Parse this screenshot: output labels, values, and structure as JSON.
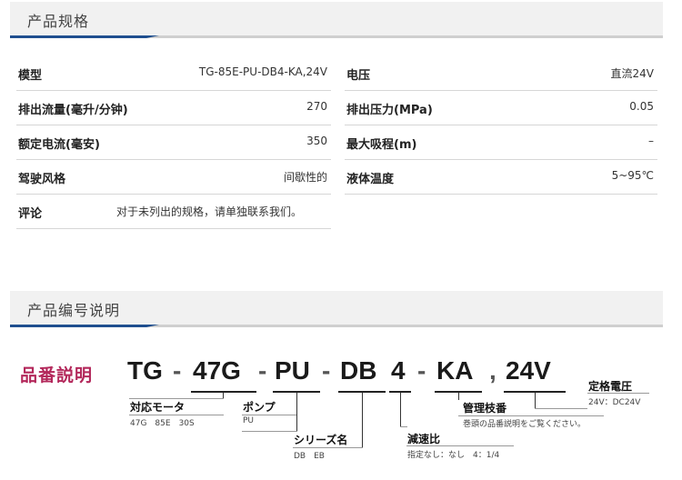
{
  "spec_section": {
    "title": "产品规格"
  },
  "spec_left": [
    {
      "label": "模型",
      "value": "TG-85E-PU-DB4-KA,24V"
    },
    {
      "label": "排出流量(毫升/分钟)",
      "value": "270"
    },
    {
      "label": "额定电流(毫安)",
      "value": "350"
    },
    {
      "label": "驾驶风格",
      "value": "间歇性的"
    }
  ],
  "spec_right": [
    {
      "label": "电压",
      "value": "直流24V"
    },
    {
      "label": "排出压力(MPa)",
      "value": "0.05"
    },
    {
      "label": "最大吸程(m)",
      "value": "–"
    },
    {
      "label": "液体温度",
      "value": "5~95℃"
    }
  ],
  "comment": {
    "label": "评论",
    "value": "对于未列出的规格，请单独联系我们。"
  },
  "code_section": {
    "title": "产品编号说明"
  },
  "code": {
    "heading": "品番説明",
    "parts": {
      "p1": "TG",
      "d1": "-",
      "p2": "47G",
      "d2": "-",
      "p3": "PU",
      "d3": "-",
      "p4": "DB",
      "p5": "4",
      "d4": "-",
      "p6": "KA",
      "d5": ",",
      "p7": "24V"
    },
    "labels": {
      "motor": {
        "title": "対応モータ",
        "sub": "47G　85E　30S"
      },
      "pump": {
        "title": "ポンプ",
        "sub": "PU"
      },
      "series": {
        "title": "シリーズ名",
        "sub": "DB　EB"
      },
      "reduction": {
        "title": "減速比",
        "sub": "指定なし：なし　4：1/4"
      },
      "branch": {
        "title": "管理枝番",
        "sub": "巻頭の品番説明をご覧ください。"
      },
      "voltage": {
        "title": "定格電圧",
        "sub": "24V：DC24V"
      }
    }
  },
  "colors": {
    "accent_blue": "#1f4f8f",
    "heading_magenta": "#b3285b",
    "header_bg": "#f1f1f1"
  }
}
